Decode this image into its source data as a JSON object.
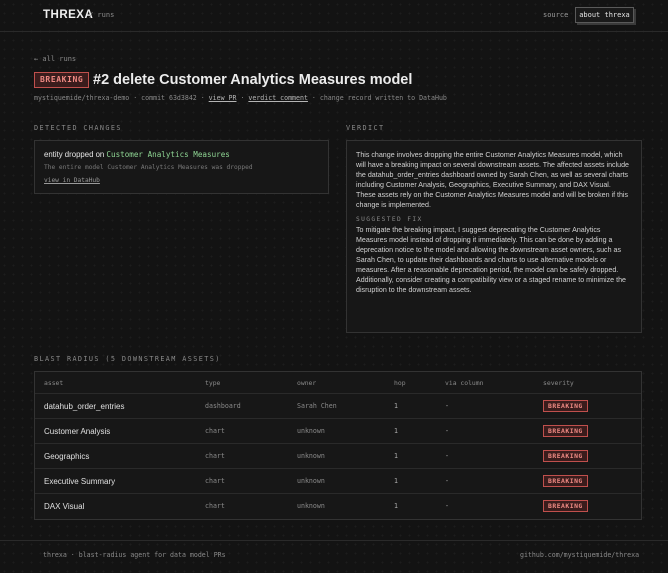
{
  "header": {
    "brand": "THREXA",
    "crumb": "/ runs",
    "nav_source": "source",
    "nav_about": "about threxa"
  },
  "back_link": "← all runs",
  "run": {
    "badge": "BREAKING",
    "title": "#2 delete Customer Analytics Measures model",
    "meta_prefix": "mystiquemide/threxa-demo · commit 63d3842 · ",
    "view_pr": "view PR",
    "sep": " · ",
    "verdict_comment": "verdict comment",
    "meta_suffix": " · change record written to DataHub"
  },
  "detected_changes": {
    "label": "DETECTED CHANGES",
    "prefix": "entity dropped on ",
    "model": "Customer Analytics Measures",
    "description": "The entire model Customer Analytics Measures was dropped",
    "link": "view in DataHub"
  },
  "verdict": {
    "label": "VERDICT",
    "text": "This change involves dropping the entire Customer Analytics Measures model, which will have a breaking impact on several downstream assets. The affected assets include the datahub_order_entries dashboard owned by Sarah Chen, as well as several charts including Customer Analysis, Geographics, Executive Summary, and DAX Visual. These assets rely on the Customer Analytics Measures model and will be broken if this change is implemented.",
    "fix_label": "SUGGESTED FIX",
    "fix_text": "To mitigate the breaking impact, I suggest deprecating the Customer Analytics Measures model instead of dropping it immediately. This can be done by adding a deprecation notice to the model and allowing the downstream asset owners, such as Sarah Chen, to update their dashboards and charts to use alternative models or measures. After a reasonable deprecation period, the model can be safely dropped. Additionally, consider creating a compatibility view or a staged rename to minimize the disruption to the downstream assets."
  },
  "blast_radius": {
    "label": "BLAST RADIUS (5 DOWNSTREAM ASSETS)",
    "columns": {
      "asset": "asset",
      "type": "type",
      "owner": "owner",
      "hop": "hop",
      "via": "via column",
      "severity": "severity"
    },
    "rows": [
      {
        "asset": "datahub_order_entries",
        "type": "dashboard",
        "owner": "Sarah Chen",
        "hop": "1",
        "via": "-",
        "severity": "BREAKING"
      },
      {
        "asset": "Customer Analysis",
        "type": "chart",
        "owner": "unknown",
        "hop": "1",
        "via": "-",
        "severity": "BREAKING"
      },
      {
        "asset": "Geographics",
        "type": "chart",
        "owner": "unknown",
        "hop": "1",
        "via": "-",
        "severity": "BREAKING"
      },
      {
        "asset": "Executive Summary",
        "type": "chart",
        "owner": "unknown",
        "hop": "1",
        "via": "-",
        "severity": "BREAKING"
      },
      {
        "asset": "DAX Visual",
        "type": "chart",
        "owner": "unknown",
        "hop": "1",
        "via": "-",
        "severity": "BREAKING"
      }
    ]
  },
  "footer": {
    "left": "threxa · blast-radius agent for data model PRs",
    "right": "github.com/mystiquemide/threxa"
  },
  "colors": {
    "accent_breaking": "#c0504d",
    "model_green": "#8fd694"
  }
}
